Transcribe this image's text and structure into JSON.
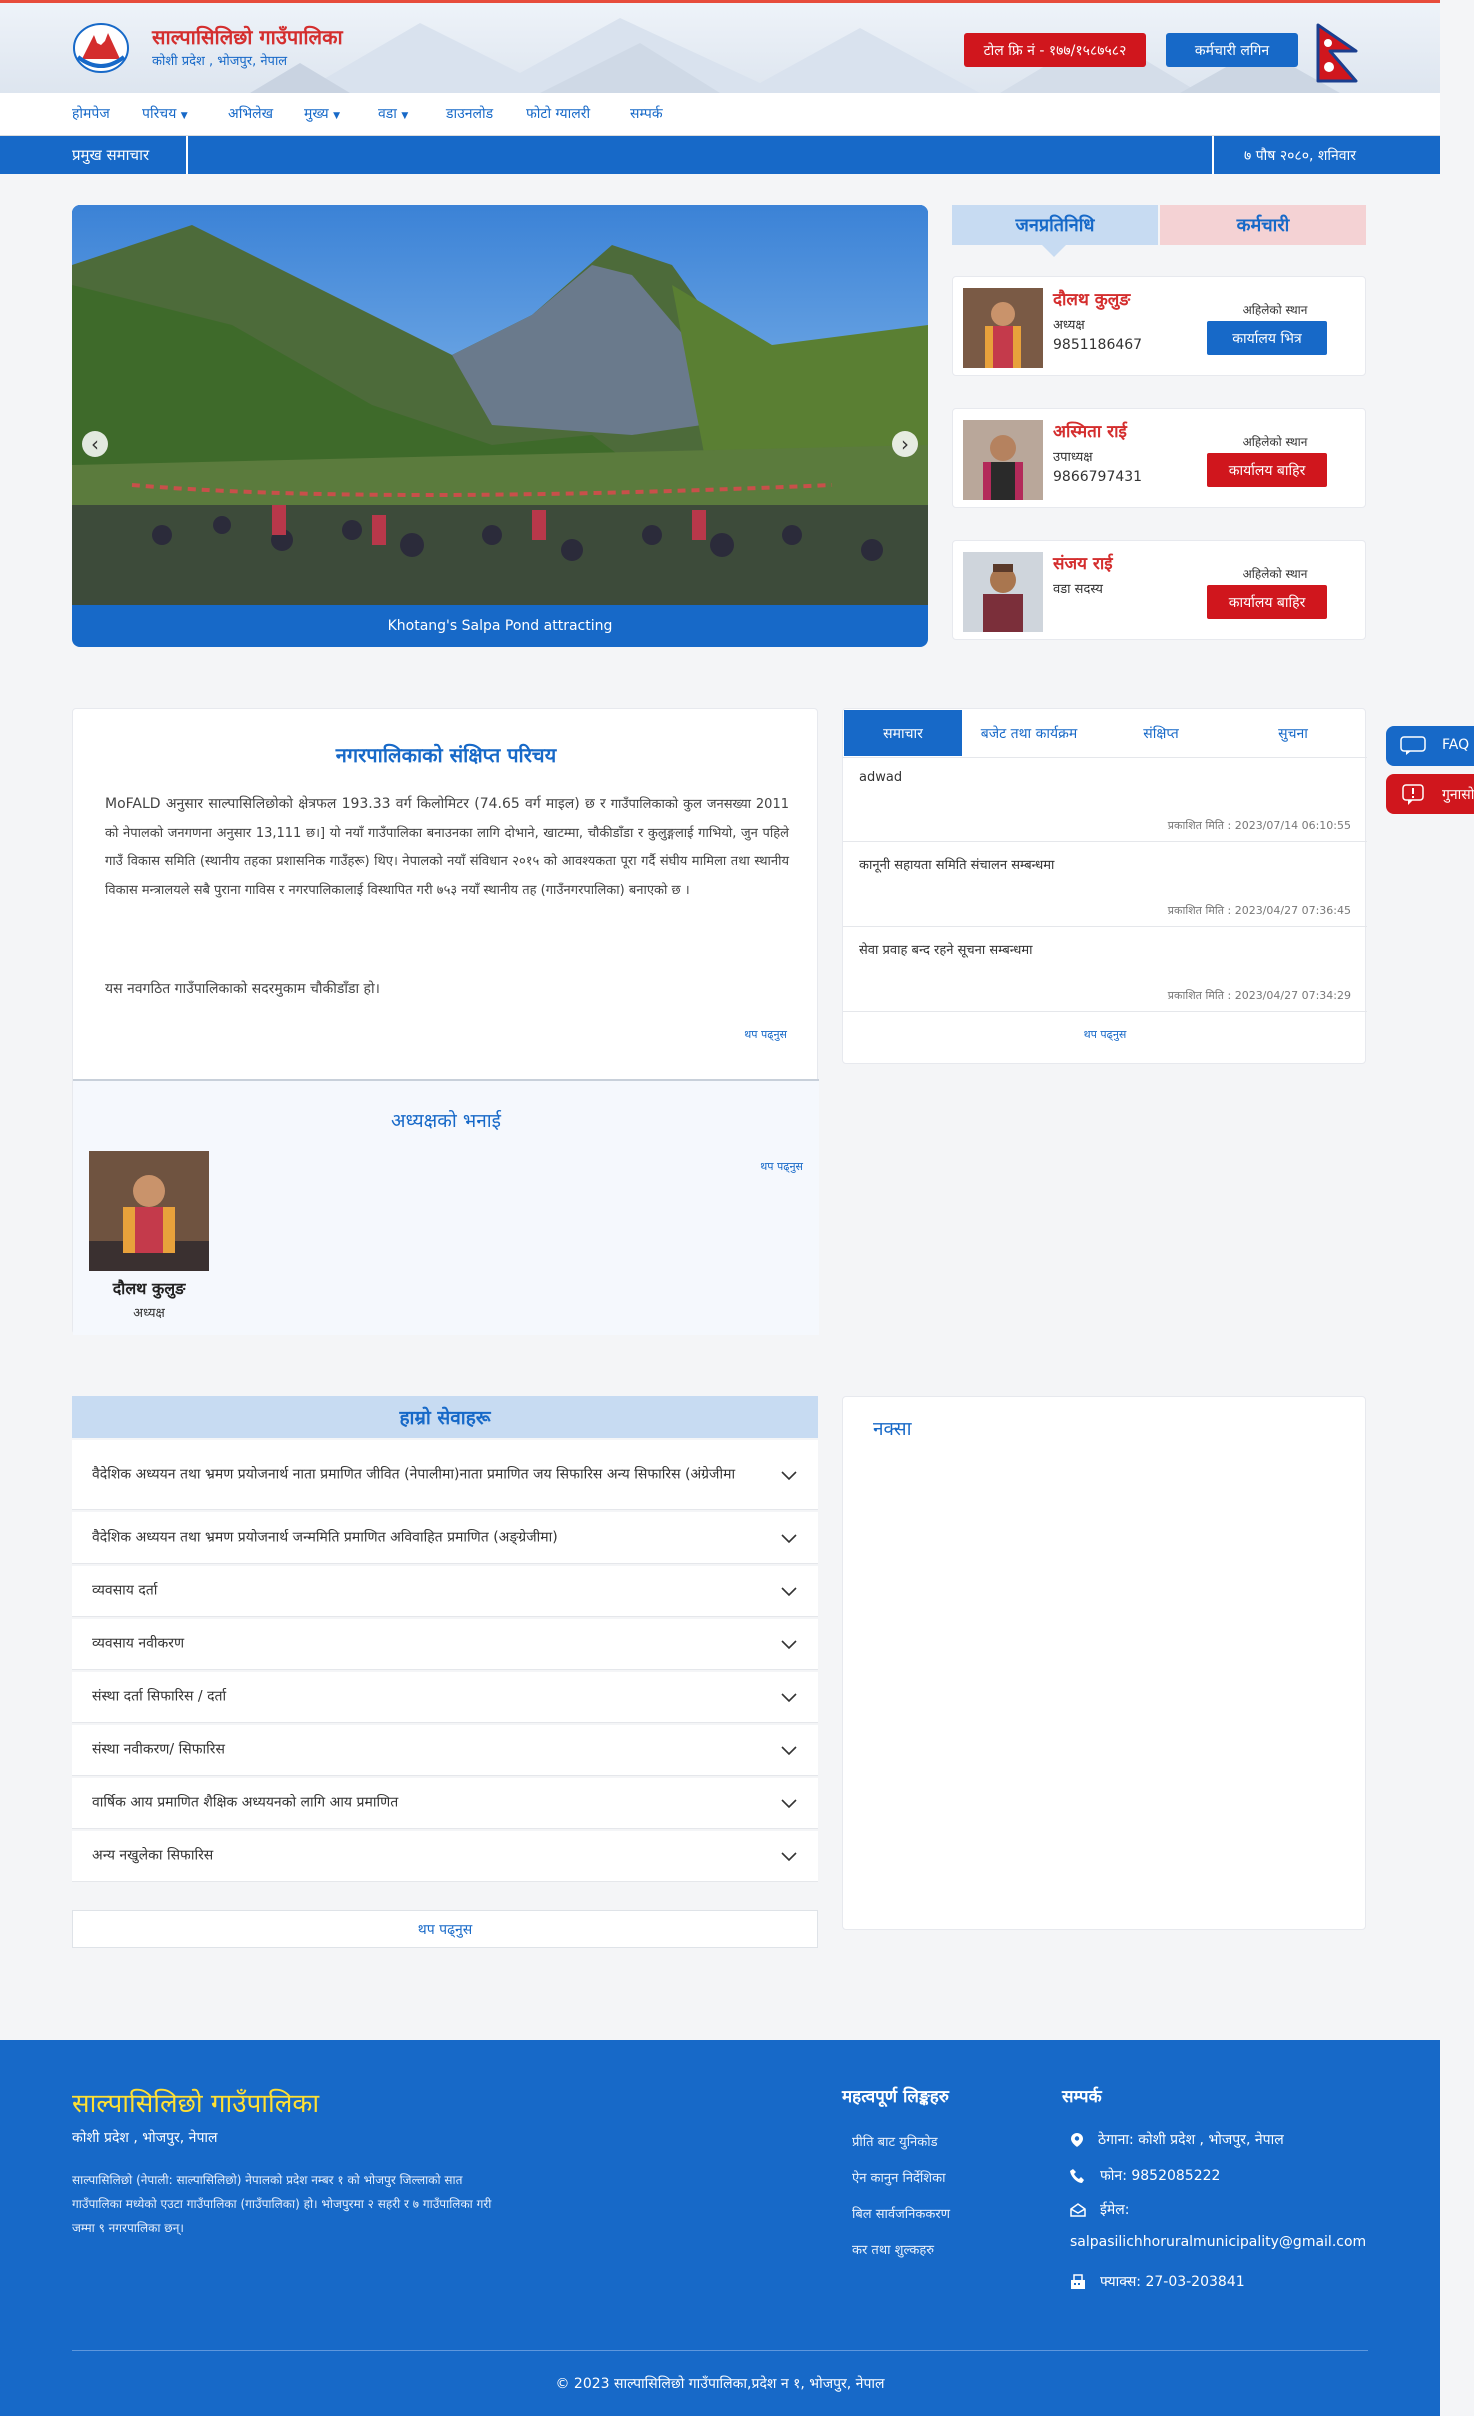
{
  "header": {
    "title": "साल्पासिलिछो गाउँपालिका",
    "subtitle": "कोशी प्रदेश , भोजपुर, नेपाल",
    "hotline": "टोल फ्रि नं - १७७/१५८७५८२",
    "staff_login": "कर्मचारी लगिन"
  },
  "nav": [
    "होमपेज",
    "परिचय",
    "अभिलेख",
    "मुख्य",
    "वडा",
    "डाउनलोड",
    "फोटो ग्यालरी",
    "सम्पर्क"
  ],
  "news_bar": {
    "label": "प्रमुख समाचार",
    "date": "७ पौष २०८०, शनिवार"
  },
  "slider": {
    "caption": "Khotang's Salpa Pond attracting"
  },
  "rep_tabs": {
    "representatives": "जनप्रतिनिधि",
    "staff": "कर्मचारी"
  },
  "representatives": [
    {
      "name": "दौलथ कुलुङ",
      "role": "अध्यक्ष",
      "phone": "9851186467",
      "location_label": "अहिलेको स्थान",
      "status": "कार्यालय भित्र",
      "status_color": "#1769c8"
    },
    {
      "name": "अस्मिता राई",
      "role": "उपाध्यक्ष",
      "phone": "9866797431",
      "location_label": "अहिलेको स्थान",
      "status": "कार्यालय बाहिर",
      "status_color": "#d0161d"
    },
    {
      "name": "संजय राई",
      "role": "वडा सदस्य",
      "phone": "",
      "location_label": "अहिलेको स्थान",
      "status": "कार्यालय बाहिर",
      "status_color": "#d0161d"
    }
  ],
  "about": {
    "title": "नगरपालिकाको संक्षिप्त परिचय",
    "body_lead": "MoFALD अनुसार साल्पासिलिछोको क्षेत्रफल 193.33 वर्ग किलोमिटर (74.65 वर्ग माइल) छ र",
    "body": "गाउँपालिकाको कुल जनसख्या 2011 को नेपालको जनगणना अनुसार 13,111 छ।] यो नयाँ गाउँपालिका बनाउनका लागि दोभाने, खाटम्मा, चौकीडाँडा र कुलुङ्गलाई गाभियो, जुन पहिले गाउँ विकास समिति (स्थानीय तहका प्रशासनिक गाउँहरू) थिए। नेपालको नयाँ संविधान २०१५ को आवश्यकता पूरा गर्दै संघीय मामिला तथा स्थानीय विकास मन्त्रालयले सबै पुराना गाविस र नगरपालिकालाई विस्थापित गरी ७५३ नयाँ स्थानीय तह (गाउँनगरपालिका) बनाएको छ ।",
    "body2": "यस नवगठित गाउँपालिकाको सदरमुकाम चौकीडाँडा हो।",
    "read_more": "थप पढ्नुस"
  },
  "chair": {
    "title": "अध्यक्षको भनाई",
    "read_more": "थप पढ्नुस",
    "name": "दौलथ कुलुङ",
    "role": "अध्यक्ष"
  },
  "news_tabs": [
    "समाचार",
    "बजेट तथा कार्यक्रम",
    "संक्षिप्त",
    "सुचना"
  ],
  "news_items": [
    {
      "title": "adwad",
      "date": "प्रकाशित मिति : 2023/07/14 06:10:55"
    },
    {
      "title": "कानूनी सहायता समिति संचालन सम्बन्धमा",
      "date": "प्रकाशित मिति : 2023/04/27 07:36:45"
    },
    {
      "title": "सेवा प्रवाह बन्द रहने सूचना सम्बन्धमा",
      "date": "प्रकाशित मिति : 2023/04/27 07:34:29"
    }
  ],
  "news_more": "थप पढ्नुस",
  "side_buttons": {
    "faq": "FAQ",
    "complaint": "गुनासो"
  },
  "services": {
    "title": "हाम्रो सेवाहरू",
    "items": [
      "वैदेशिक अध्ययन तथा भ्रमण प्रयोजनार्थ नाता प्रमाणित जीवित (नेपालीमा)नाता प्रमाणित जय सिफारिस अन्य सिफारिस (अंग्रेजीमा",
      "वैदेशिक अध्ययन तथा भ्रमण प्रयोजनार्थ जन्ममिति प्रमाणित अविवाहित प्रमाणित (अङ्ग्रेजीमा)",
      "व्यवसाय दर्ता",
      "व्यवसाय नवीकरण",
      "संस्था दर्ता सिफारिस / दर्ता",
      "संस्था नवीकरण/ सिफारिस",
      "वार्षिक आय प्रमाणित शैक्षिक अध्ययनको लागि आय प्रमाणित",
      "अन्य नखुलेका सिफारिस"
    ],
    "read_more": "थप पढ्नुस"
  },
  "map": {
    "title": "नक्सा"
  },
  "footer": {
    "title": "साल्पासिलिछो गाउँपालिका",
    "subtitle": "कोशी प्रदेश , भोजपुर, नेपाल",
    "description": "साल्पासिलिछो (नेपाली: साल्पासिलिछो) नेपालको प्रदेश नम्बर १ को भोजपुर जिल्लाको सात गाउँपालिका मध्येको एउटा गाउँपालिका (गाउँपालिका) हो। भोजपुरमा २ सहरी र ७ गाउँपालिका गरी जम्मा ९ नगरपालिका छन्।",
    "links_title": "महत्वपूर्ण लिङ्कहरु",
    "links": [
      "प्रीति बाट युनिकोड",
      "ऐन कानुन निर्देशिका",
      "बिल सार्वजनिककरण",
      "कर तथा शुल्कहरु"
    ],
    "contact_title": "सम्पर्क",
    "address": "ठेगाना: कोशी प्रदेश , भोजपुर, नेपाल",
    "phone": "फोन: 9852085222",
    "email_label": "ईमेल:",
    "email": "salpasilichhoruralmunicipality@gmail.com",
    "fax": "फ्याक्स: 27-03-203841",
    "copyright": "© 2023 साल्पासिलिछो गाउँपालिका,प्रदेश न १, भोजपुर, नेपाल"
  }
}
